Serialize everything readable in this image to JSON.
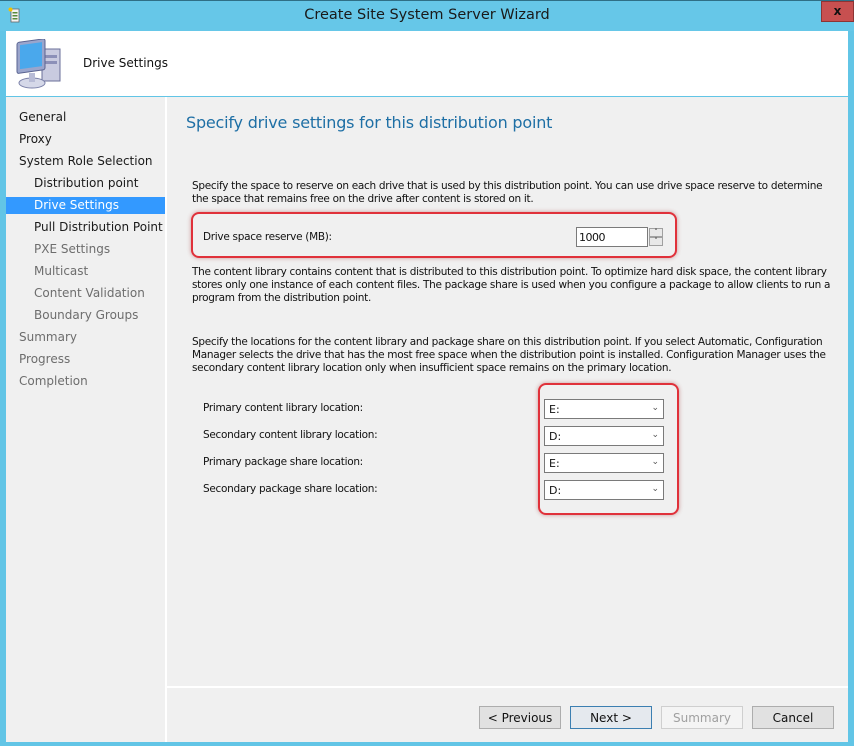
{
  "window": {
    "title": "Create Site System Server Wizard",
    "close_label": "x",
    "app_icon": "wizard-app-icon"
  },
  "header": {
    "title": "Drive Settings",
    "icon": "computer-icon"
  },
  "sidebar": {
    "items": [
      {
        "label": "General",
        "level": 0,
        "state": "normal"
      },
      {
        "label": "Proxy",
        "level": 0,
        "state": "normal"
      },
      {
        "label": "System Role Selection",
        "level": 0,
        "state": "normal"
      },
      {
        "label": "Distribution point",
        "level": 1,
        "state": "normal"
      },
      {
        "label": "Drive Settings",
        "level": 1,
        "state": "active"
      },
      {
        "label": "Pull Distribution Point",
        "level": 1,
        "state": "normal"
      },
      {
        "label": "PXE Settings",
        "level": 1,
        "state": "dim"
      },
      {
        "label": "Multicast",
        "level": 1,
        "state": "dim"
      },
      {
        "label": "Content Validation",
        "level": 1,
        "state": "dim"
      },
      {
        "label": "Boundary Groups",
        "level": 1,
        "state": "dim"
      },
      {
        "label": "Summary",
        "level": 0,
        "state": "dim"
      },
      {
        "label": "Progress",
        "level": 0,
        "state": "dim"
      },
      {
        "label": "Completion",
        "level": 0,
        "state": "dim"
      }
    ]
  },
  "main": {
    "title": "Specify drive settings for this distribution point",
    "intro": "Specify the space to reserve on each drive that is used by this distribution point. You can use drive space reserve to determine the space that remains free on the drive after content is stored on it.",
    "reserve": {
      "label": "Drive space reserve (MB):",
      "value": "1000",
      "up": "˄",
      "down": "˅"
    },
    "content_library_text": "The content library contains content that is distributed to this distribution point. To optimize hard disk space, the content library stores only one instance of each content files. The package share is used when you configure a package to allow clients to run a program from the distribution point.",
    "locations_text": "Specify the locations for the content library and package share on this distribution point. If you select Automatic, Configuration Manager selects the drive that has the most free space when the distribution point is installed. Configuration Manager uses the secondary content library location only when insufficient space remains on the primary location.",
    "locations": [
      {
        "label": "Primary content library location:",
        "value": "E:"
      },
      {
        "label": "Secondary content library location:",
        "value": "D:"
      },
      {
        "label": "Primary package share location:",
        "value": "E:"
      },
      {
        "label": "Secondary package share location:",
        "value": "D:"
      }
    ],
    "dropdown_arrow": "⌄",
    "highlight_color": "#e0313a"
  },
  "footer": {
    "previous": "< Previous",
    "next": "Next >",
    "summary": "Summary",
    "cancel": "Cancel"
  }
}
